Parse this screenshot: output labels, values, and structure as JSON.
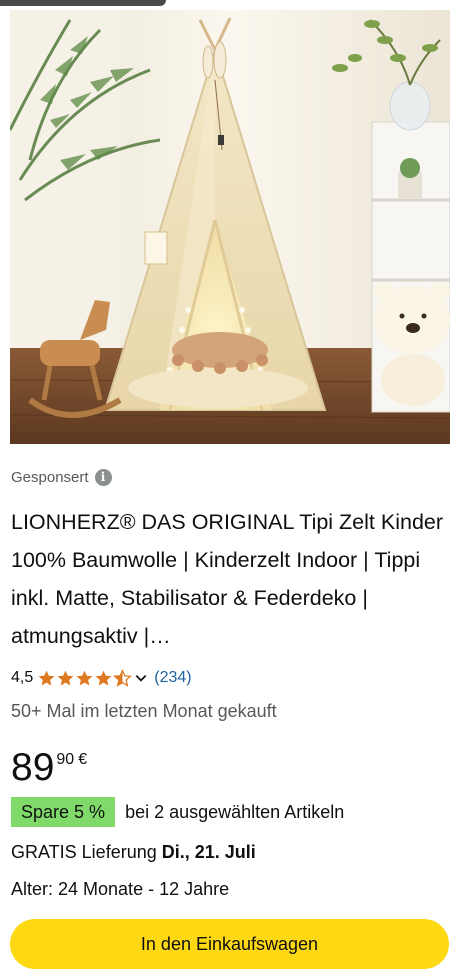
{
  "product": {
    "sponsored_label": "Gesponsert",
    "title": "LIONHERZ® DAS ORIGINAL Tipi Zelt Kinder 100% Baumwolle | Kinderzelt Indoor | Tippi inkl. Matte, Stabilisator & Federdeko | atmungsaktiv |…",
    "rating_value": "4,5",
    "rating_stars": 4.5,
    "review_count": "(234)",
    "bought_text": "50+ Mal im letzten Monat gekauft",
    "price_whole": "89",
    "price_fraction": "90",
    "price_currency": "€",
    "save_badge": "Spare 5 %",
    "save_text": "bei 2 ausgewählten Artikeln",
    "delivery_prefix": "GRATIS Lieferung",
    "delivery_date": "Di., 21. Juli",
    "age_text": "Alter: 24 Monate - 12 Jahre",
    "cart_button": "In den Einkaufswagen"
  },
  "icons": {
    "info": "info-icon",
    "star": "star-icon",
    "chevron": "chevron-down-icon"
  },
  "colors": {
    "star": "#de7921",
    "link": "#2162a1",
    "save_badge": "#7fda69",
    "cart_button": "#ffd814"
  }
}
